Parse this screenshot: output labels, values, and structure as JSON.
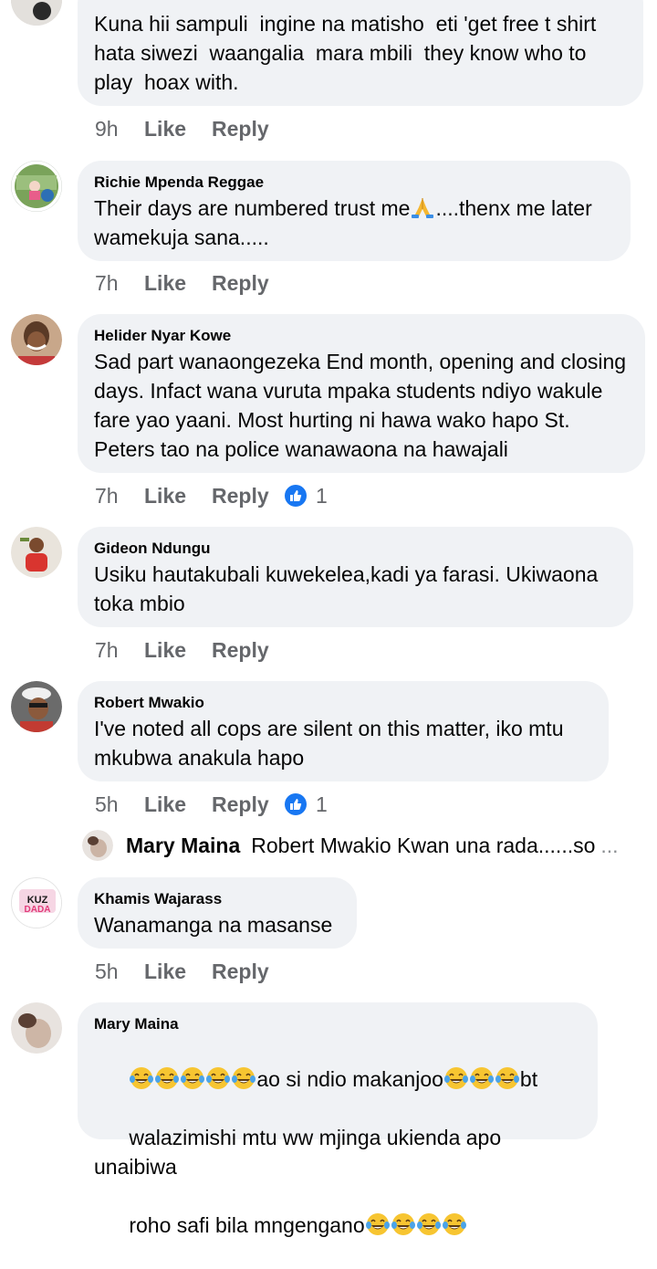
{
  "comments": [
    {
      "author": "",
      "text": "Kuna hii sampuli  ingine na matisho  eti 'get free t shirt hata siwezi  waangalia  mara mbili  they know who to play  hoax with.",
      "time": "9h",
      "like": "Like",
      "reply": "Reply"
    },
    {
      "author": "Richie Mpenda Reggae",
      "text_before": "Their days are numbered trust me",
      "text_after": "....thenx me later wamekuja sana.....",
      "emoji": "praying-hands-icon",
      "time": "7h",
      "like": "Like",
      "reply": "Reply"
    },
    {
      "author": "Helider Nyar Kowe",
      "text": "Sad part wanaongezeka End month, opening and closing days. Infact wana vuruta mpaka students ndiyo wakule fare yao yaani. Most hurting ni hawa wako hapo St. Peters tao na police wanawaona na hawajali",
      "time": "7h",
      "like": "Like",
      "reply": "Reply",
      "reactions": "1"
    },
    {
      "author": "Gideon Ndungu",
      "text": "Usiku hautakubali kuwekelea,kadi ya farasi. Ukiwaona toka mbio",
      "time": "7h",
      "like": "Like",
      "reply": "Reply"
    },
    {
      "author": "Robert Mwakio",
      "text": "I've noted all cops are silent on this matter, iko mtu mkubwa anakula hapo",
      "time": "5h",
      "like": "Like",
      "reply": "Reply",
      "reactions": "1"
    },
    {
      "author": "Khamis Wajarass",
      "text": "Wanamanga na masanse",
      "time": "5h",
      "like": "Like",
      "reply": "Reply"
    },
    {
      "author": "Mary Maina",
      "line1_text": "ao si ndio makanjoo",
      "line1_end": "bt",
      "line2": "walazimishi mtu ww mjinga ukienda apo unaibiwa",
      "line3": "roho safi bila mngengano",
      "emoji": "tears-of-joy-icon"
    }
  ],
  "reply_preview": {
    "author": "Mary Maina",
    "text": "Robert Mwakio Kwan una rada......so",
    "more": "..."
  },
  "avatar_labels": {
    "khamis_top": "KUZ",
    "khamis_bottom": "DADA"
  },
  "colors": {
    "bubble": "#f0f2f5",
    "meta": "#65676b",
    "reaction": "#1877f2"
  }
}
